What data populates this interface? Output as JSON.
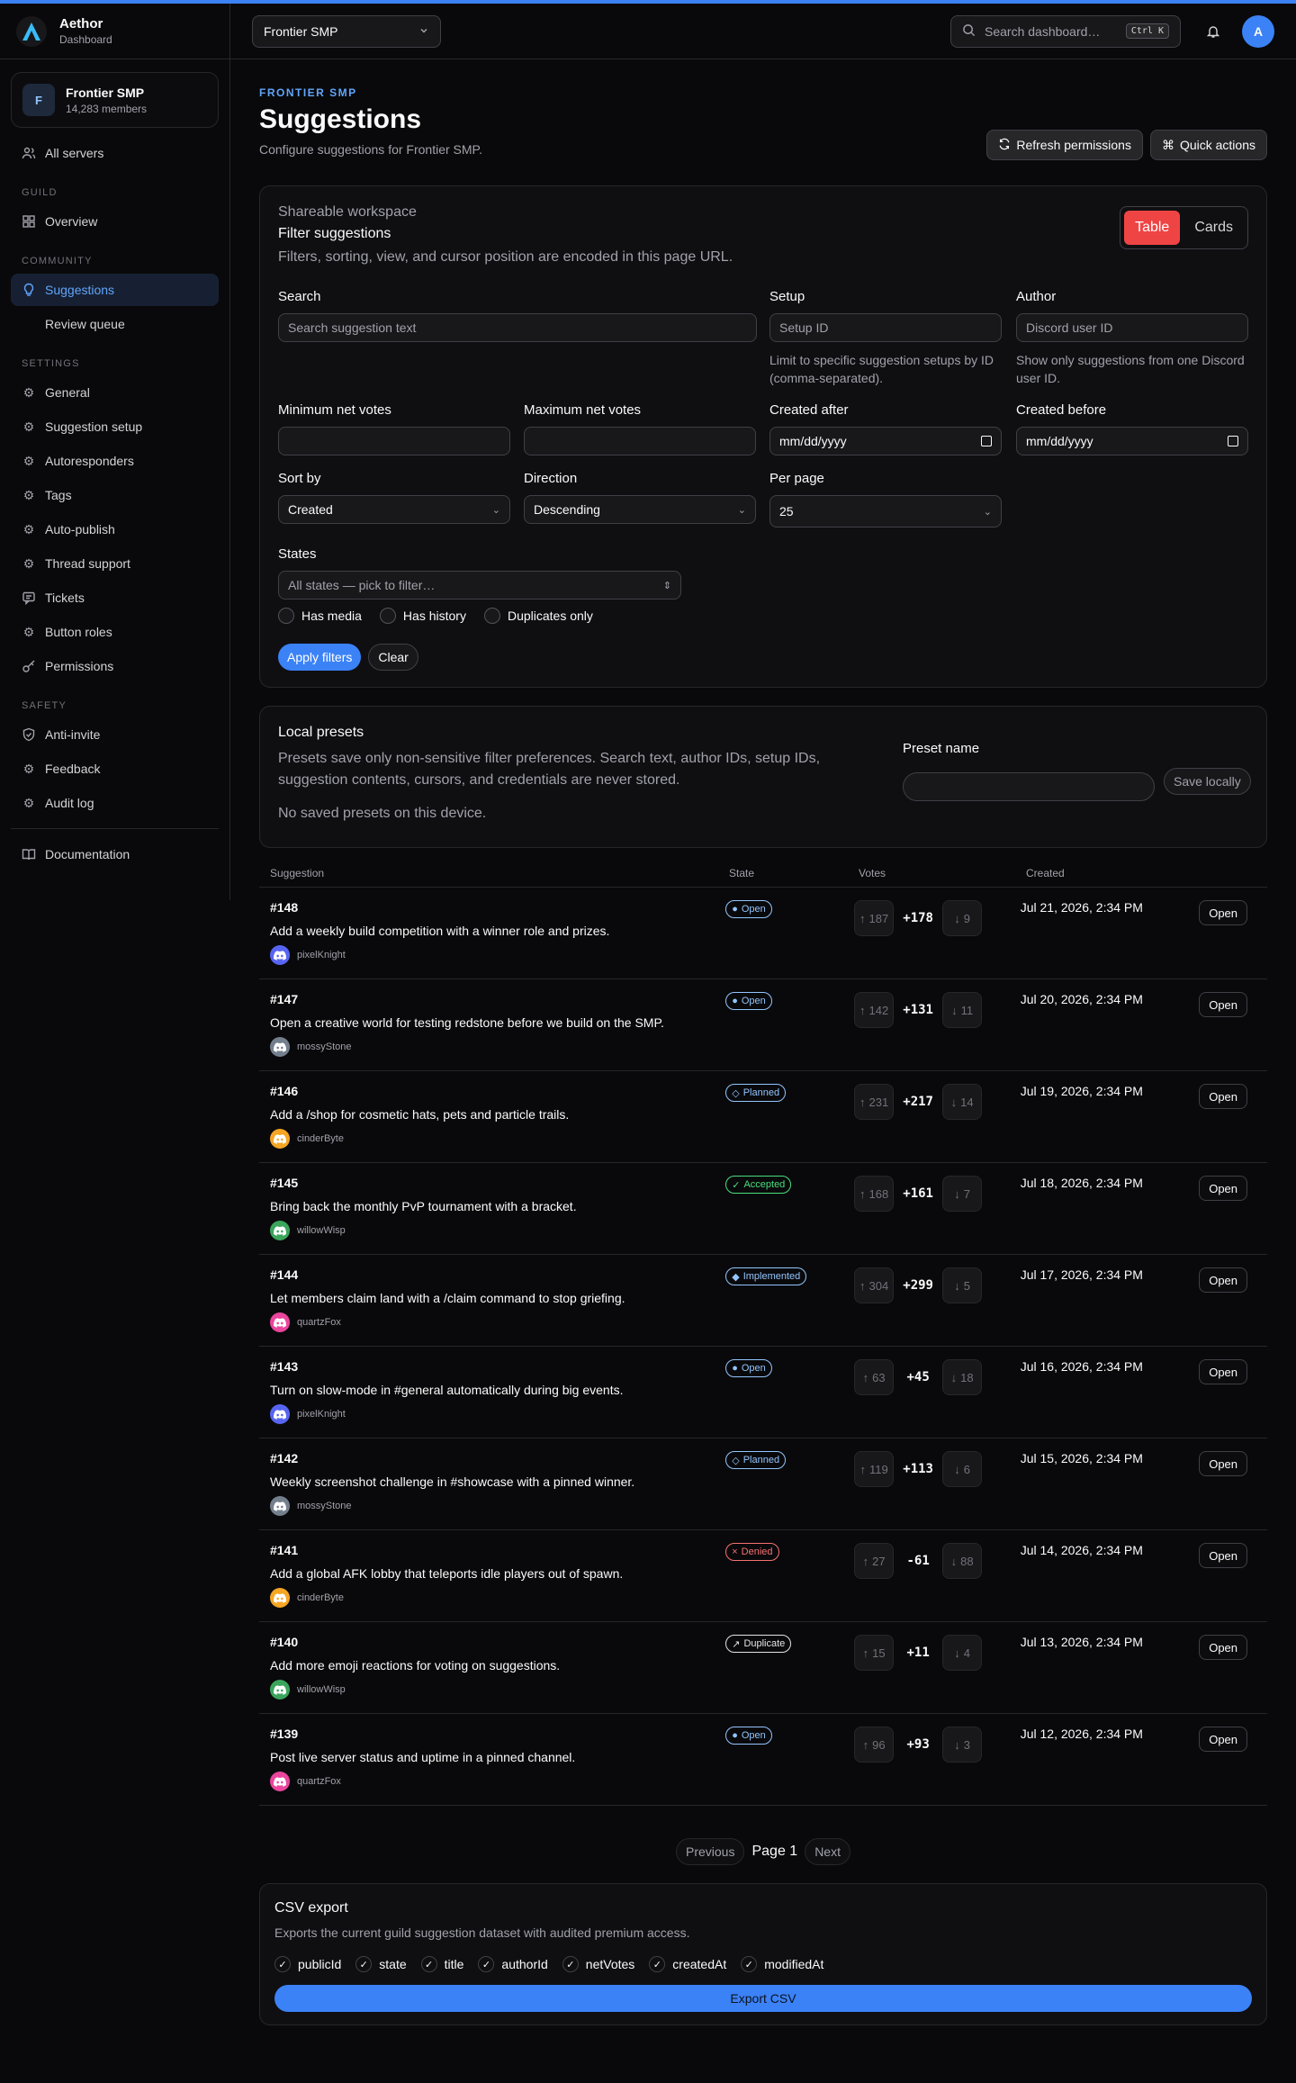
{
  "brand": {
    "name": "Aethor",
    "subtitle": "Dashboard"
  },
  "server": {
    "name": "Frontier SMP",
    "members": "14,283 members",
    "initial": "F"
  },
  "sidebar": {
    "all_servers": "All servers",
    "sections": {
      "guild": "GUILD",
      "community": "COMMUNITY",
      "settings": "SETTINGS",
      "safety": "SAFETY"
    },
    "guild_items": [
      {
        "label": "Overview"
      }
    ],
    "community_items": [
      {
        "label": "Suggestions"
      },
      {
        "label": "Review queue"
      }
    ],
    "settings_items": [
      {
        "label": "General"
      },
      {
        "label": "Suggestion setup"
      },
      {
        "label": "Autoresponders"
      },
      {
        "label": "Tags"
      },
      {
        "label": "Auto-publish"
      },
      {
        "label": "Thread support"
      },
      {
        "label": "Tickets"
      },
      {
        "label": "Button roles"
      },
      {
        "label": "Permissions"
      }
    ],
    "safety_items": [
      {
        "label": "Anti-invite"
      },
      {
        "label": "Feedback"
      },
      {
        "label": "Audit log"
      }
    ],
    "documentation": "Documentation"
  },
  "topbar": {
    "server_select": "Frontier SMP",
    "search_placeholder": "Search dashboard…",
    "shortcut": "Ctrl K",
    "user_initial": "A"
  },
  "header": {
    "eyebrow": "FRONTIER SMP",
    "title": "Suggestions",
    "description": "Configure suggestions for Frontier SMP.",
    "refresh": "Refresh permissions",
    "quick": "Quick actions"
  },
  "filters": {
    "kicker": "Shareable workspace",
    "title": "Filter suggestions",
    "description": "Filters, sorting, view, and cursor position are encoded in this page URL.",
    "view_table": "Table",
    "view_cards": "Cards",
    "search": {
      "label": "Search",
      "placeholder": "Search suggestion text"
    },
    "setup": {
      "label": "Setup",
      "placeholder": "Setup ID",
      "hint": "Limit to specific suggestion setups by ID (comma-separated)."
    },
    "author": {
      "label": "Author",
      "placeholder": "Discord user ID",
      "hint": "Show only suggestions from one Discord user ID."
    },
    "min_votes": {
      "label": "Minimum net votes"
    },
    "max_votes": {
      "label": "Maximum net votes"
    },
    "created_after": {
      "label": "Created after",
      "value": "mm/dd/yyyy"
    },
    "created_before": {
      "label": "Created before",
      "value": "mm/dd/yyyy"
    },
    "sort_by": {
      "label": "Sort by",
      "value": "Created"
    },
    "direction": {
      "label": "Direction",
      "value": "Descending"
    },
    "per_page": {
      "label": "Per page",
      "value": "25"
    },
    "states": {
      "label": "States",
      "placeholder": "All states — pick to filter…"
    },
    "has_media": "Has media",
    "has_history": "Has history",
    "duplicates_only": "Duplicates only",
    "apply": "Apply filters",
    "clear": "Clear"
  },
  "presets": {
    "title": "Local presets",
    "description": "Presets save only non-sensitive filter preferences. Search text, author IDs, setup IDs, suggestion contents, cursors, and credentials are never stored.",
    "empty": "No saved presets on this device.",
    "name_label": "Preset name",
    "save": "Save locally"
  },
  "table": {
    "headers": {
      "suggestion": "Suggestion",
      "state": "State",
      "votes": "Votes",
      "created": "Created"
    },
    "open_label": "Open",
    "rows": [
      {
        "id": "#148",
        "title": "Add a weekly build competition with a winner role and prizes.",
        "author": "pixelKnight",
        "avatar_color": "#5865f2",
        "state": "Open",
        "state_icon": "●",
        "state_kind": "open",
        "up": "187",
        "net": "+178",
        "down": "9",
        "created": "Jul 21, 2026, 2:34 PM"
      },
      {
        "id": "#147",
        "title": "Open a creative world for testing redstone before we build on the SMP.",
        "author": "mossyStone",
        "avatar_color": "#747f8d",
        "state": "Open",
        "state_icon": "●",
        "state_kind": "open",
        "up": "142",
        "net": "+131",
        "down": "11",
        "created": "Jul 20, 2026, 2:34 PM"
      },
      {
        "id": "#146",
        "title": "Add a /shop for cosmetic hats, pets and particle trails.",
        "author": "cinderByte",
        "avatar_color": "#f5a623",
        "state": "Planned",
        "state_icon": "◇",
        "state_kind": "planned",
        "up": "231",
        "net": "+217",
        "down": "14",
        "created": "Jul 19, 2026, 2:34 PM"
      },
      {
        "id": "#145",
        "title": "Bring back the monthly PvP tournament with a bracket.",
        "author": "willowWisp",
        "avatar_color": "#3ba55c",
        "state": "Accepted",
        "state_icon": "✓",
        "state_kind": "accepted",
        "up": "168",
        "net": "+161",
        "down": "7",
        "created": "Jul 18, 2026, 2:34 PM"
      },
      {
        "id": "#144",
        "title": "Let members claim land with a /claim command to stop griefing.",
        "author": "quartzFox",
        "avatar_color": "#eb459e",
        "state": "Implemented",
        "state_icon": "◆",
        "state_kind": "implemented",
        "up": "304",
        "net": "+299",
        "down": "5",
        "created": "Jul 17, 2026, 2:34 PM"
      },
      {
        "id": "#143",
        "title": "Turn on slow-mode in #general automatically during big events.",
        "author": "pixelKnight",
        "avatar_color": "#5865f2",
        "state": "Open",
        "state_icon": "●",
        "state_kind": "open",
        "up": "63",
        "net": "+45",
        "down": "18",
        "created": "Jul 16, 2026, 2:34 PM"
      },
      {
        "id": "#142",
        "title": "Weekly screenshot challenge in #showcase with a pinned winner.",
        "author": "mossyStone",
        "avatar_color": "#747f8d",
        "state": "Planned",
        "state_icon": "◇",
        "state_kind": "planned",
        "up": "119",
        "net": "+113",
        "down": "6",
        "created": "Jul 15, 2026, 2:34 PM"
      },
      {
        "id": "#141",
        "title": "Add a global AFK lobby that teleports idle players out of spawn.",
        "author": "cinderByte",
        "avatar_color": "#f5a623",
        "state": "Denied",
        "state_icon": "×",
        "state_kind": "denied",
        "up": "27",
        "net": "-61",
        "down": "88",
        "created": "Jul 14, 2026, 2:34 PM"
      },
      {
        "id": "#140",
        "title": "Add more emoji reactions for voting on suggestions.",
        "author": "willowWisp",
        "avatar_color": "#3ba55c",
        "state": "Duplicate",
        "state_icon": "↗",
        "state_kind": "duplicate",
        "up": "15",
        "net": "+11",
        "down": "4",
        "created": "Jul 13, 2026, 2:34 PM"
      },
      {
        "id": "#139",
        "title": "Post live server status and uptime in a pinned channel.",
        "author": "quartzFox",
        "avatar_color": "#eb459e",
        "state": "Open",
        "state_icon": "●",
        "state_kind": "open",
        "up": "96",
        "net": "+93",
        "down": "3",
        "created": "Jul 12, 2026, 2:34 PM"
      }
    ]
  },
  "pagination": {
    "previous": "Previous",
    "page": "Page 1",
    "next": "Next"
  },
  "export": {
    "title": "CSV export",
    "description": "Exports the current guild suggestion dataset with audited premium access.",
    "columns": [
      "publicId",
      "state",
      "title",
      "authorId",
      "netVotes",
      "createdAt",
      "modifiedAt"
    ],
    "button": "Export CSV"
  },
  "state_colors": {
    "open": "#93c5fd",
    "planned": "#93c5fd",
    "accepted": "#4ade80",
    "implemented": "#93c5fd",
    "denied": "#f87171",
    "duplicate": "#e4e4e7"
  }
}
